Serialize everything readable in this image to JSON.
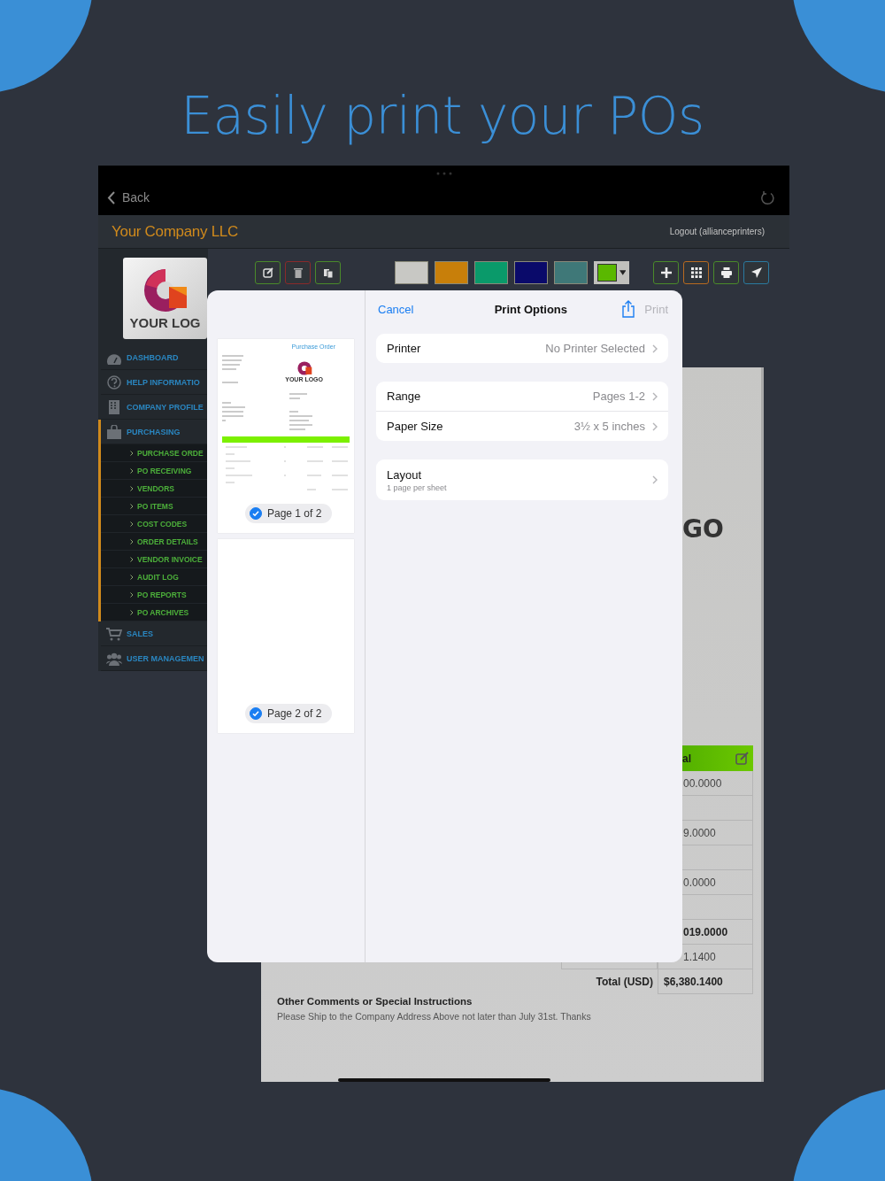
{
  "headline": "Easily print your POs",
  "nav_bar": {
    "back": "Back"
  },
  "header": {
    "company": "Your Company LLC",
    "logout": "Logout (allianceprinters)"
  },
  "sidebar": {
    "logo": "YOUR LOG",
    "items": [
      {
        "label": "DASHBOARD",
        "expanded": false
      },
      {
        "label": "HELP INFORMATIO",
        "expanded": false
      },
      {
        "label": "COMPANY PROFILE",
        "expanded": false
      },
      {
        "label": "PURCHASING",
        "expanded": true,
        "children": [
          {
            "label": "PURCHASE ORDE"
          },
          {
            "label": "PO RECEIVING"
          },
          {
            "label": "VENDORS"
          },
          {
            "label": "PO ITEMS"
          },
          {
            "label": "COST CODES"
          },
          {
            "label": "ORDER DETAILS"
          },
          {
            "label": "VENDOR INVOICE"
          },
          {
            "label": "AUDIT LOG"
          },
          {
            "label": "PO REPORTS"
          },
          {
            "label": "PO ARCHIVES"
          }
        ]
      },
      {
        "label": "SALES",
        "expanded": false
      },
      {
        "label": "USER MANAGEMEN",
        "expanded": false
      }
    ]
  },
  "toolbar": {
    "swatches": [
      {
        "color": "#c8c8c4"
      },
      {
        "color": "#c87f0a"
      },
      {
        "color": "#0a9a6a"
      },
      {
        "color": "#0a0a6a"
      },
      {
        "color": "#3f7878"
      }
    ],
    "color_picker": {
      "color": "#5ab800"
    }
  },
  "document": {
    "logo_tail": "GO",
    "table": {
      "header": "al",
      "rows": [
        {
          "kind": "value",
          "value": "00.0000",
          "bold": false
        },
        {
          "kind": "blank"
        },
        {
          "kind": "value",
          "value": "9.0000",
          "bold": false
        },
        {
          "kind": "blank"
        },
        {
          "kind": "value",
          "value": "0.0000",
          "bold": false
        },
        {
          "kind": "blank"
        },
        {
          "kind": "value",
          "value": "019.0000",
          "bold": true
        },
        {
          "kind": "value",
          "value": "1.1400",
          "bold": false
        },
        {
          "kind": "total",
          "label": "Total (USD)",
          "value": "$6,380.1400"
        }
      ]
    },
    "comments": {
      "title": "Other Comments or Special Instructions",
      "text": "Please Ship to the Company Address Above not later than July 31st. Thanks"
    }
  },
  "dialog": {
    "cancel": "Cancel",
    "title": "Print Options",
    "print": {
      "label": "Print",
      "disabled": true
    },
    "preview": {
      "title": "Purchase Order",
      "logo": "YOUR LOGO"
    },
    "pages": [
      {
        "label": "Page 1 of 2",
        "selected": true
      },
      {
        "label": "Page 2 of 2",
        "selected": true
      }
    ],
    "groups": [
      {
        "rows": [
          {
            "label": "Printer",
            "value": "No Printer Selected"
          }
        ]
      },
      {
        "rows": [
          {
            "label": "Range",
            "value": "Pages 1-2"
          },
          {
            "label": "Paper Size",
            "value": "3½ x 5 inches"
          }
        ]
      },
      {
        "rows": [
          {
            "label": "Layout",
            "detail": "1 page per sheet"
          }
        ]
      }
    ]
  }
}
